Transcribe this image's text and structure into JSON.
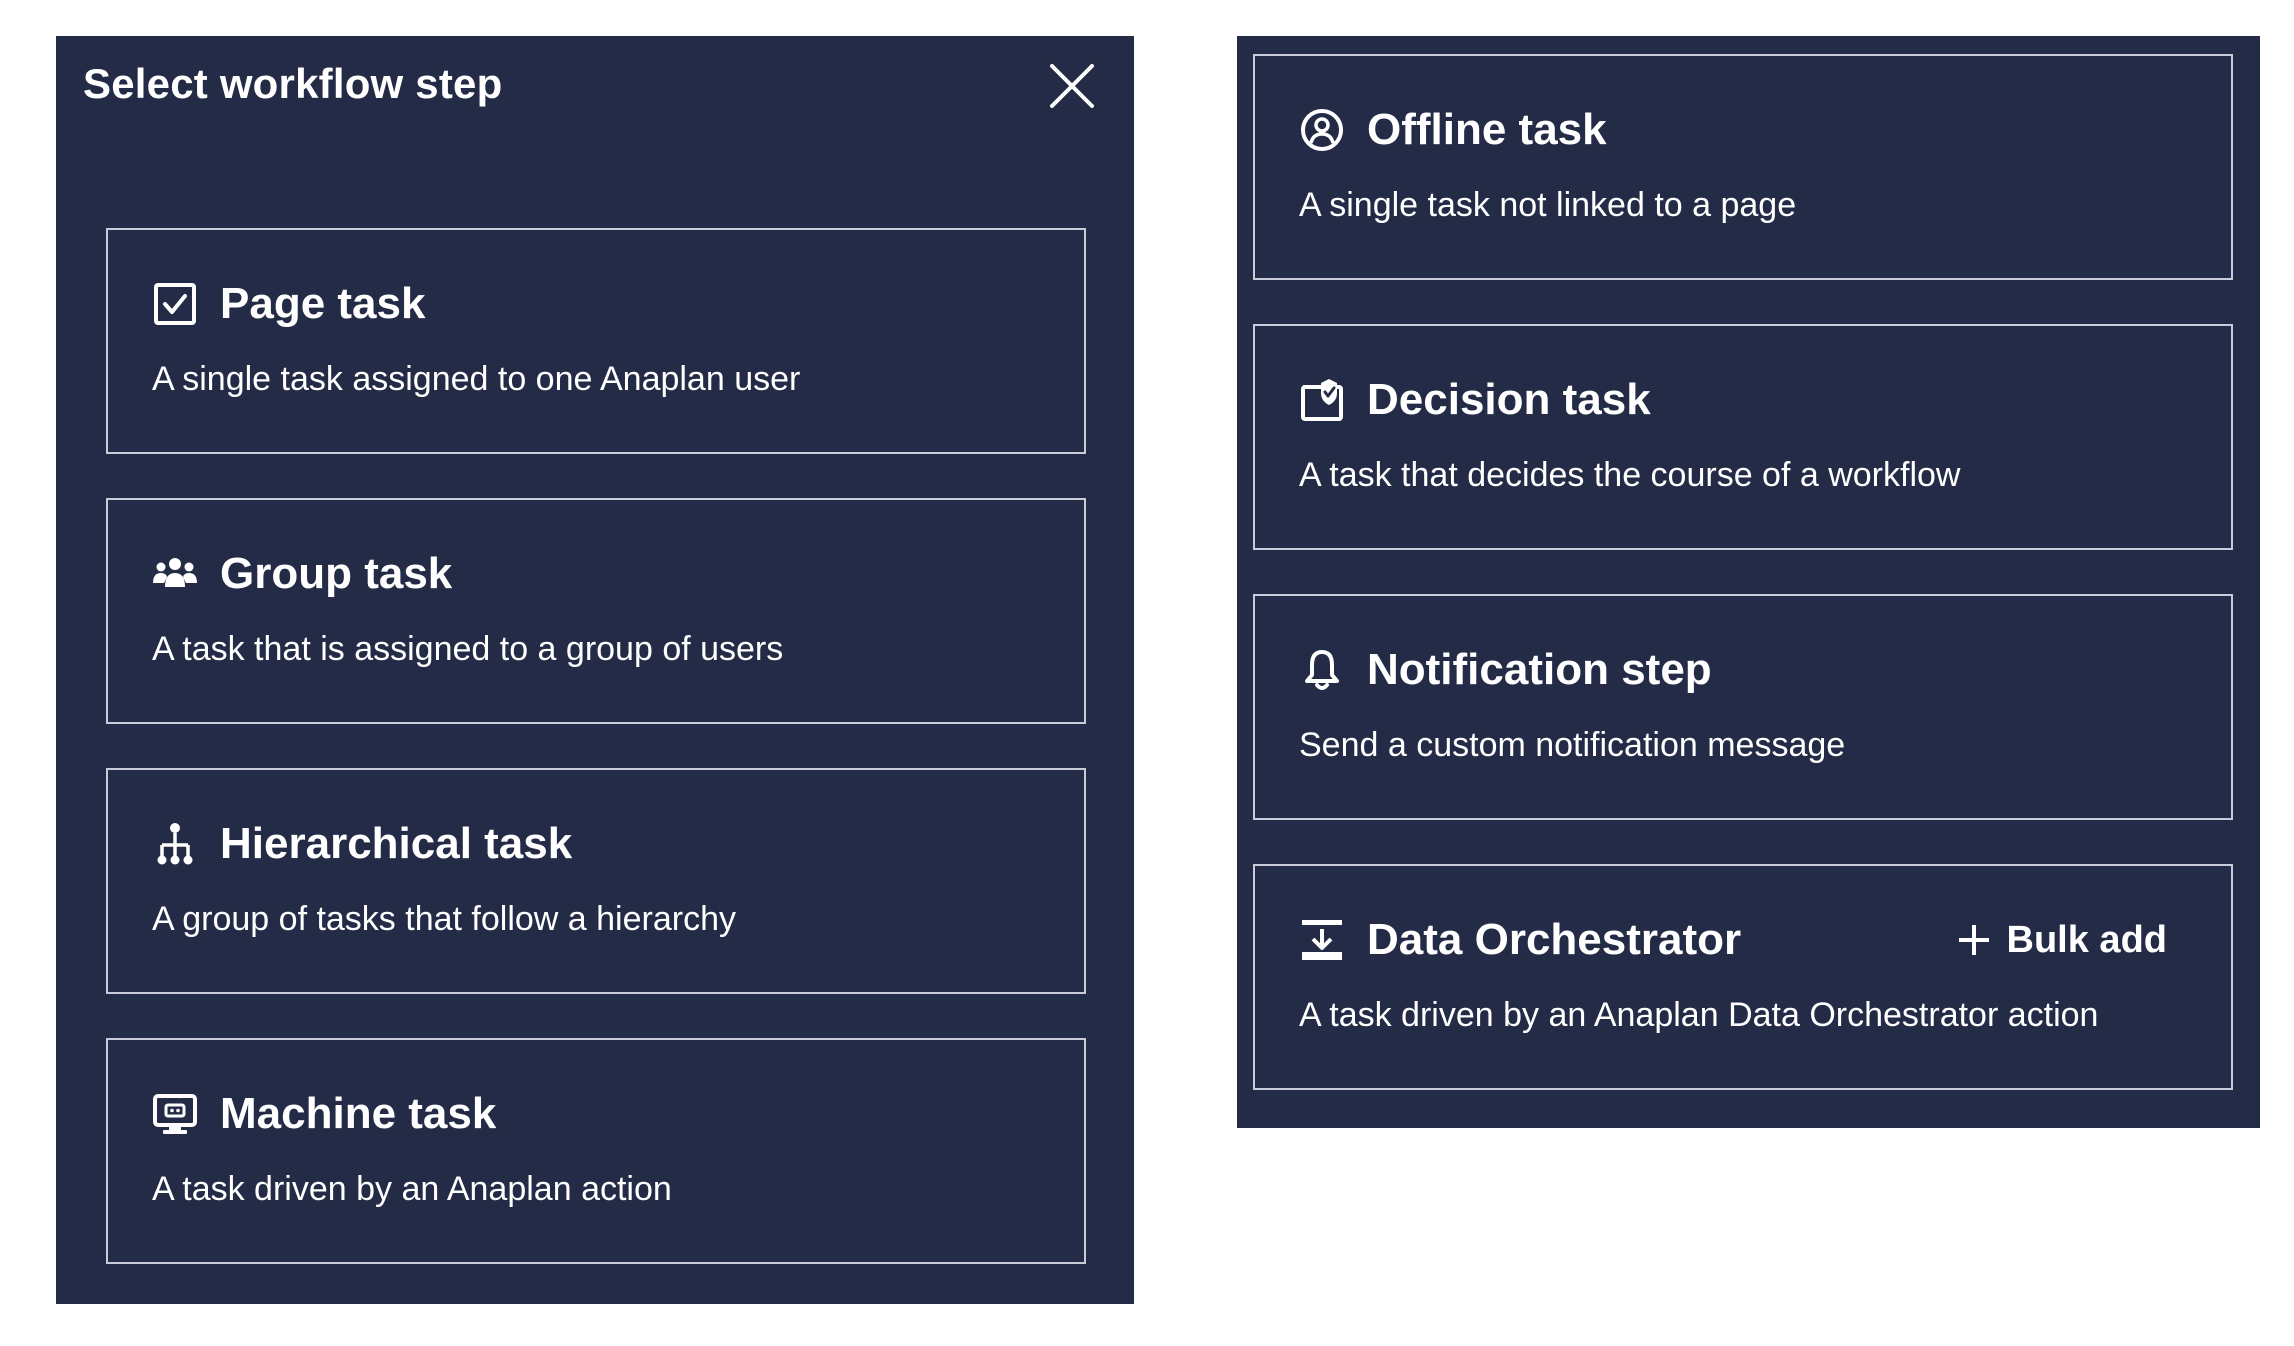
{
  "dialog": {
    "title": "Select workflow step",
    "close_icon": "close-icon"
  },
  "left_steps": [
    {
      "title": "Page task",
      "description": "A single task assigned to one Anaplan user",
      "icon": "checkbox-page-icon"
    },
    {
      "title": "Group task",
      "description": "A task that is assigned to a group of users",
      "icon": "group-users-icon"
    },
    {
      "title": "Hierarchical task",
      "description": "A group of tasks that follow a hierarchy",
      "icon": "hierarchy-icon"
    },
    {
      "title": "Machine task",
      "description": "A task driven by an Anaplan action",
      "icon": "machine-screen-icon"
    }
  ],
  "right_steps": [
    {
      "title": "Offline task",
      "description": "A single task not linked to a page",
      "icon": "user-circle-icon"
    },
    {
      "title": "Decision task",
      "description": "A task that decides the course of a workflow",
      "icon": "decision-check-icon"
    },
    {
      "title": "Notification step",
      "description": "Send a custom notification message",
      "icon": "bell-icon"
    },
    {
      "title": "Data Orchestrator",
      "description": "A task driven by an Anaplan Data Orchestrator action",
      "icon": "data-import-icon",
      "action_label": "Bulk add",
      "action_icon": "plus-icon"
    }
  ],
  "colors": {
    "panel_background": "#232b46",
    "card_border": "#c9ccd8",
    "text": "#ffffff"
  }
}
